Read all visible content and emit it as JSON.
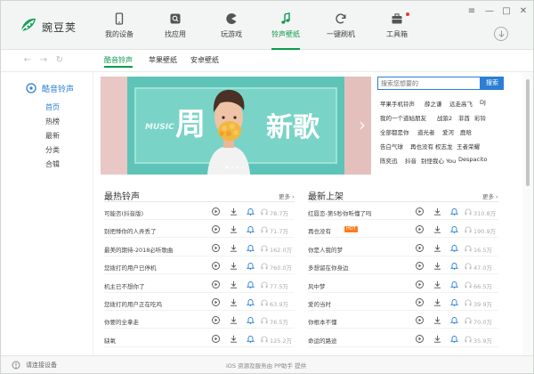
{
  "app": {
    "name": "豌豆荚"
  },
  "nav": [
    {
      "label": "我的设备",
      "icon": "phone-icon"
    },
    {
      "label": "找应用",
      "icon": "app-store-icon"
    },
    {
      "label": "玩游戏",
      "icon": "game-pacman-icon"
    },
    {
      "label": "铃声壁纸",
      "icon": "music-note-icon",
      "active": true
    },
    {
      "label": "一键刷机",
      "icon": "refresh-icon"
    },
    {
      "label": "工具箱",
      "icon": "toolbox-icon",
      "badge": true
    }
  ],
  "window_controls": [
    "≡",
    "—",
    "□",
    "✕"
  ],
  "subtabs": [
    {
      "label": "酷音铃声",
      "active": true
    },
    {
      "label": "苹果壁纸"
    },
    {
      "label": "安卓壁纸"
    }
  ],
  "sidebar": {
    "title": "酷音铃声",
    "items": [
      "首页",
      "热榜",
      "最新",
      "分类",
      "合辑"
    ],
    "active_index": 0
  },
  "banner": {
    "music": "MUSIC",
    "headline1": "周",
    "headline2": "新歌"
  },
  "search": {
    "placeholder": "搜索您想要的",
    "button": "搜索"
  },
  "hot_tags": [
    [
      "苹果手机铃声",
      "薛之谦",
      "远走高飞",
      "DJ"
    ],
    [
      "我的一个道姑朋友",
      "战狼2",
      "非酋",
      "彩铃"
    ],
    [
      "全部都是你",
      "道光者",
      "爱河",
      "鹿晗"
    ],
    [
      "告白气球",
      "再也没有",
      "权志龙",
      "王者荣耀"
    ],
    [
      "陈奕迅",
      "抖音",
      "别怪我心 You",
      "Despacito"
    ]
  ],
  "sections": {
    "hot": {
      "title": "最热铃声",
      "more": "更多",
      "songs": [
        {
          "title": "可能否(抖音版)",
          "count": "78.7万"
        },
        {
          "title": "别把悸你的人弄丢了",
          "count": "71.7万"
        },
        {
          "title": "最美的期待-2018必听歌曲",
          "count": "162.0万"
        },
        {
          "title": "您拨打的用户已停机",
          "count": "760.0万"
        },
        {
          "title": "机主已不想你了",
          "count": "77.5万"
        },
        {
          "title": "您拨打的用户正在吃鸡",
          "count": "63.9万"
        },
        {
          "title": "你要的全拿走",
          "count": "76.5万"
        },
        {
          "title": "缺氧",
          "count": "125.2万"
        }
      ]
    },
    "new": {
      "title": "最新上架",
      "more": "更多",
      "songs": [
        {
          "title": "红唇恋-第5秒你听懂了吗",
          "count": "310.8万"
        },
        {
          "title": "再也没有",
          "count": "190.9万",
          "hot": "HOT"
        },
        {
          "title": "你是人我的梦",
          "count": "16.5万"
        },
        {
          "title": "多想留在你身边",
          "count": "47.0万"
        },
        {
          "title": "风中梦",
          "count": "66.5万"
        },
        {
          "title": "爱的当时",
          "count": "39.9万"
        },
        {
          "title": "你根本不懂",
          "count": "70.0万"
        },
        {
          "title": "命运的路途",
          "count": "35.9万"
        }
      ]
    }
  },
  "status": {
    "left": "请连接设备",
    "center": "iOS 资源及服务由 PP助手 提供"
  }
}
